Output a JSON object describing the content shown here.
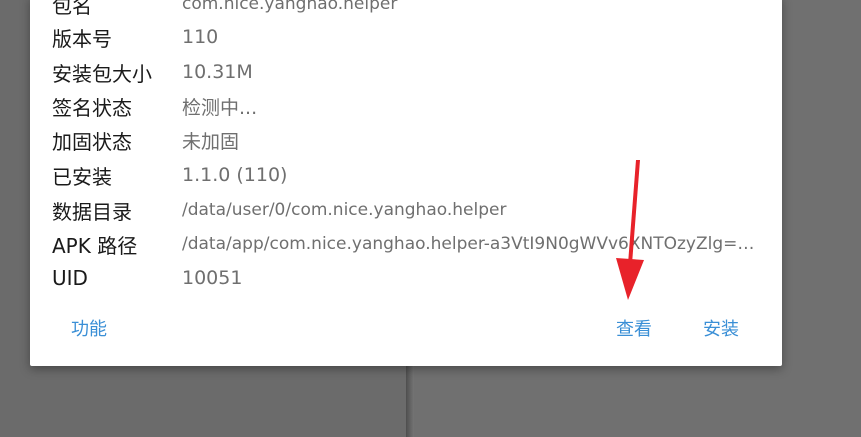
{
  "dialog": {
    "rows": [
      {
        "label": "包名",
        "value": "com.nice.yanghao.helper"
      },
      {
        "label": "版本号",
        "value": "110"
      },
      {
        "label": "安装包大小",
        "value": "10.31M"
      },
      {
        "label": "签名状态",
        "value": "检测中..."
      },
      {
        "label": "加固状态",
        "value": "未加固"
      },
      {
        "label": "已安装",
        "value": "1.1.0 (110)"
      },
      {
        "label": "数据目录",
        "value": "/data/user/0/com.nice.yanghao.helper"
      },
      {
        "label": "APK 路径",
        "value": "/data/app/com.nice.yanghao.helper-a3VtI9N0gWVv6XNTOzyZlg==/bas..."
      },
      {
        "label": "UID",
        "value": "10051"
      }
    ],
    "actions": {
      "function_label": "功能",
      "view_label": "查看",
      "install_label": "安装"
    }
  },
  "colors": {
    "accent": "#3a8fd6",
    "arrow": "#e8222a",
    "label": "#1a1a1a",
    "value": "#6f6f6f"
  }
}
